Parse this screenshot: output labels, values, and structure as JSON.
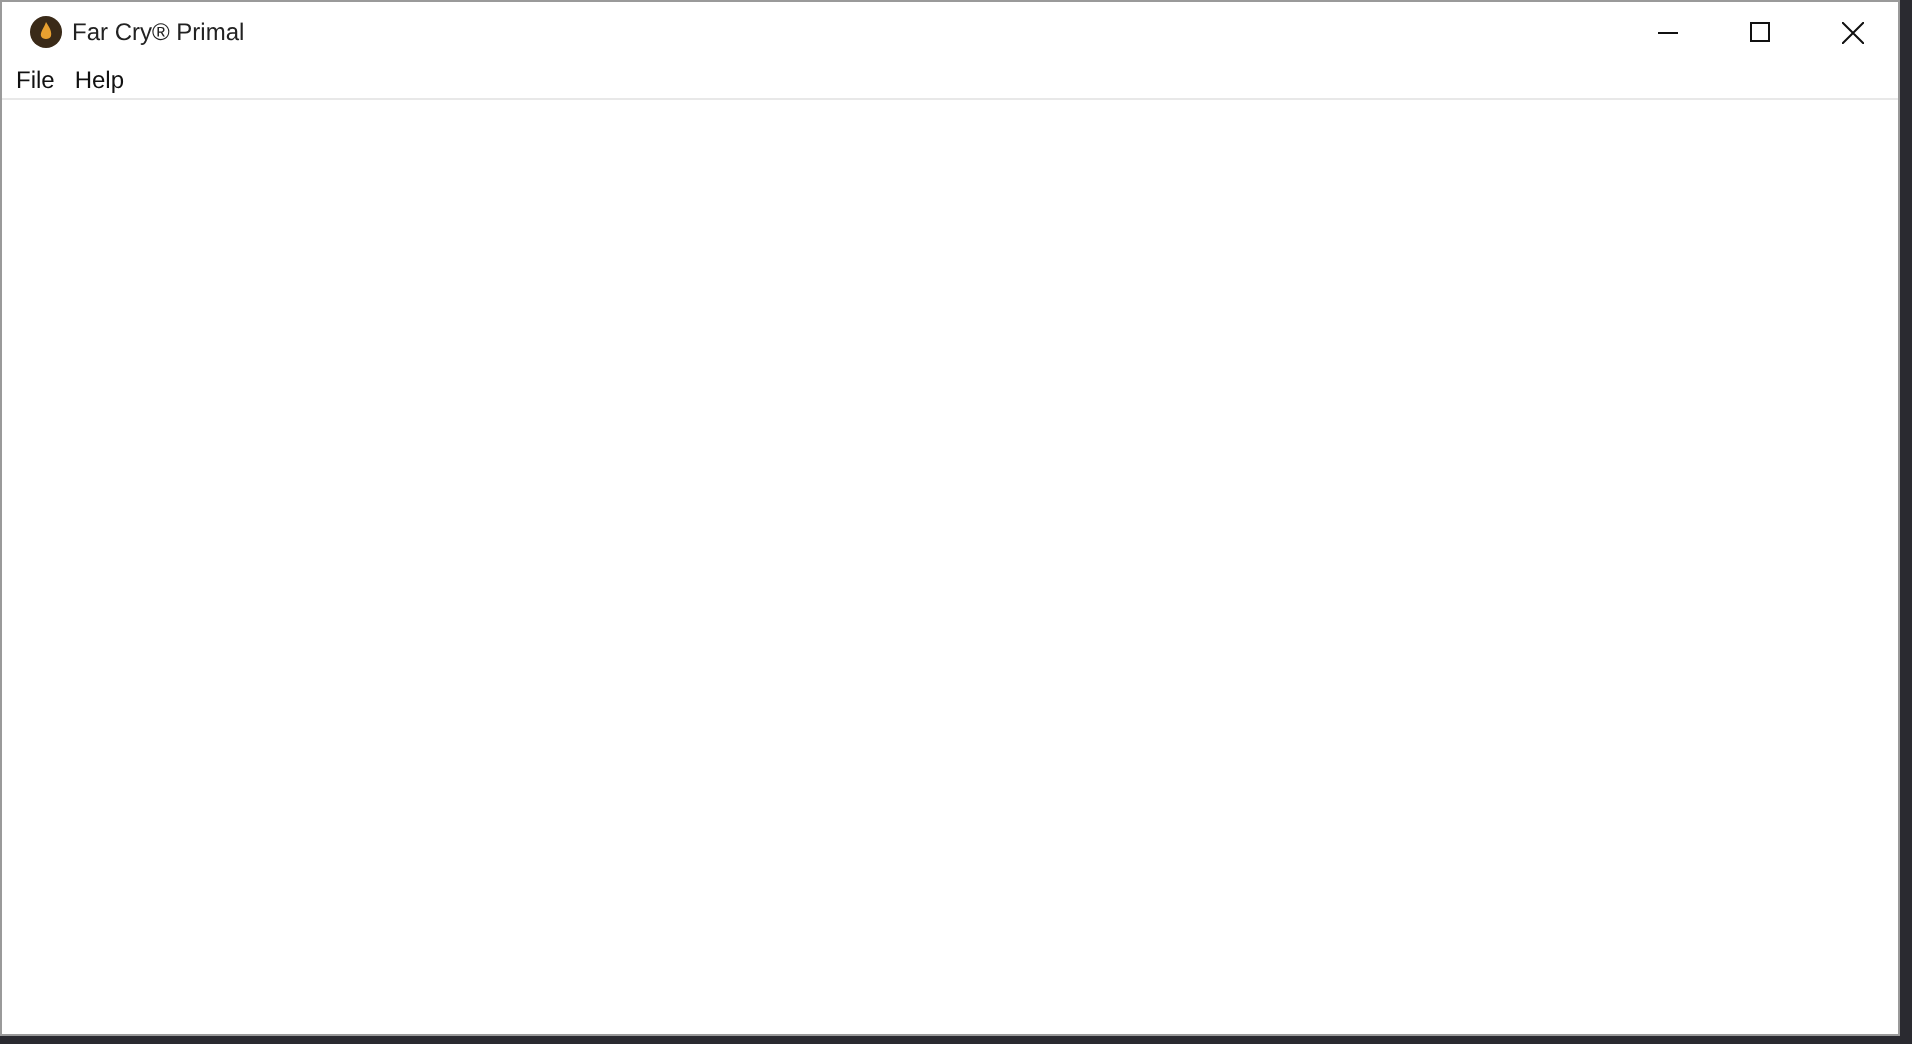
{
  "window": {
    "title": "Far Cry® Primal"
  },
  "menu": [
    {
      "label": "File"
    },
    {
      "label": "Help"
    }
  ]
}
